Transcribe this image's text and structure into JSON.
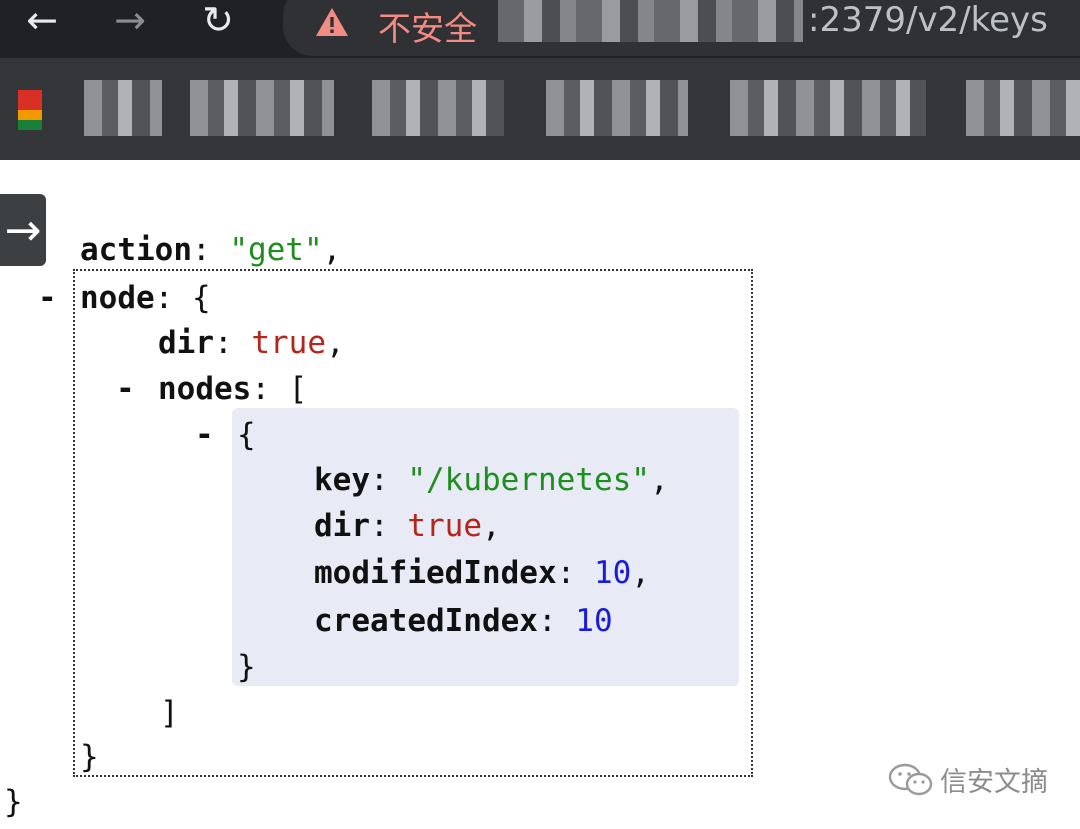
{
  "browser": {
    "nav": {
      "back": "←",
      "forward": "→",
      "reload": "↻"
    },
    "security_label": "不安全",
    "url_visible": ":2379/v2/keys"
  },
  "viewer": {
    "toggle_glyph": "→"
  },
  "json_view": {
    "root_close": "}",
    "action_key": "action",
    "action_value": "\"get\"",
    "node_key": "node",
    "node_collapse": "-",
    "node_open": "{",
    "node_close": "}",
    "dir_key": "dir",
    "dir_value": "true",
    "nodes_key": "nodes",
    "nodes_collapse": "-",
    "nodes_open": "[",
    "nodes_close": "]",
    "item_collapse": "-",
    "item_open": "{",
    "item_close": "}",
    "item": {
      "key_key": "key",
      "key_value": "\"/kubernetes\"",
      "dir_key": "dir",
      "dir_value": "true",
      "modifiedIndex_key": "modifiedIndex",
      "modifiedIndex_value": "10",
      "createdIndex_key": "createdIndex",
      "createdIndex_value": "10"
    }
  },
  "watermark": {
    "text": "信安文摘"
  },
  "colors": {
    "string": "#1e8e1e",
    "boolean": "#b3261e",
    "number": "#1a1adc",
    "insecure": "#f28b82",
    "highlight": "#e8ebf6"
  }
}
